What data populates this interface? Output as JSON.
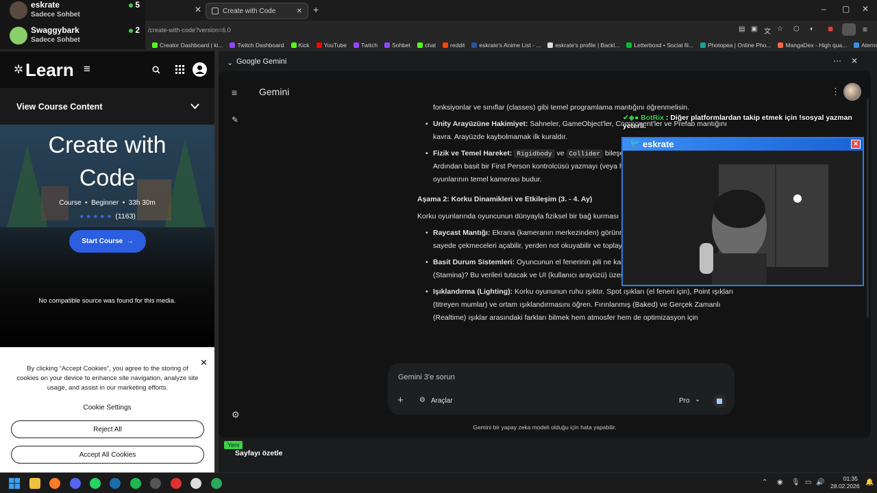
{
  "overlay": {
    "chatters": [
      {
        "name": "eskrate",
        "status": "Sadece Sohbet",
        "count": "5",
        "color": "#5a4a40"
      },
      {
        "name": "Swaggybark",
        "status": "Sadece Sohbet",
        "count": "2",
        "color": "#8ad06a"
      }
    ],
    "botrix_name": "BotRix",
    "botrix_message": "Diğer platformlardan takip etmek için !sosyal yazman yeterli.",
    "cam_title": "eskrate"
  },
  "browser": {
    "tab_title": "Create with Code",
    "url": "/create-with-code?version=6.0",
    "bookmarks": [
      {
        "label": "Creator Dashboard | ki...",
        "color": "#53fc18"
      },
      {
        "label": "Twitch Dashboard",
        "color": "#9146ff"
      },
      {
        "label": "Kick",
        "color": "#53fc18"
      },
      {
        "label": "YouTube",
        "color": "#ff0000"
      },
      {
        "label": "Twitch",
        "color": "#9146ff"
      },
      {
        "label": "Sohbet",
        "color": "#9146ff"
      },
      {
        "label": "chat",
        "color": "#53fc18"
      },
      {
        "label": "reddit",
        "color": "#ff4500"
      },
      {
        "label": "eskrate's Anime List - ...",
        "color": "#2e51a2"
      },
      {
        "label": "eskrate's profile | Backl...",
        "color": "#dddddd"
      },
      {
        "label": "Letterboxd • Social fil...",
        "color": "#00c030"
      },
      {
        "label": "Photopea | Online Pho...",
        "color": "#18a497"
      },
      {
        "label": "MangaDex - High qua...",
        "color": "#ff6740"
      },
      {
        "label": "Aternos",
        "color": "#3b8fe0"
      }
    ]
  },
  "learn": {
    "logo": "Learn",
    "view_course": "View Course Content",
    "title_line1": "Create with",
    "title_line2": "Code",
    "meta_type": "Course",
    "meta_level": "Beginner",
    "meta_duration": "33h 30m",
    "rating_count": "(1163)",
    "start_button": "Start Course",
    "no_source": "No compatible source was found for this media."
  },
  "cookie": {
    "text": "By clicking “Accept Cookies”, you agree to the storing of cookies on your device to enhance site navigation, analyze site usage, and assist in our marketing efforts.",
    "settings": "Cookie Settings",
    "reject": "Reject All",
    "accept": "Accept All Cookies"
  },
  "panel": {
    "title": "Google Gemini",
    "app_name": "Gemini",
    "bottom_badge": "Yeni",
    "bottom_action": "Sayfayı özetle"
  },
  "gemini": {
    "top_fragment": "fonksiyonlar ve sınıflar (classes) gibi temel programlama mantığını öğrenmelisin.",
    "items1": [
      {
        "bold": "Unity Arayüzüne Hakimiyet:",
        "text": " Sahneler, GameObject'ler, Component'ler ve Prefab mantığını kavra. Arayüzde kaybolmamak ilk kuraldır."
      },
      {
        "bold": "Fizik ve Temel Hareket:",
        "code1": "Rigidbody",
        "mid": " ve ",
        "code2": "Collider",
        "text": " bileşenleriyle dünyayla etkileşimini anla. Ardından basit bir First Person kontrolcüsü yazmayı (veya hazır olanları inceleyerek nasıl oyunlarının temel kamerası budur."
      }
    ],
    "stage2_title": "Aşama 2: Korku Dinamikleri ve Etkileşim (3. - 4. Ay)",
    "stage2_intro": "Korku oyunlarında oyuncunun dünyayla fiziksel bir bağ kurması",
    "items2": [
      {
        "bold": "Raycast Mantığı:",
        "text": " Ekrana (kameranın merkezinden) görünmez bir ışın göndererek algılama. Bu sayede çekmeceleri açabilir, yerden not okuyabilir ve toplayabilirsin."
      },
      {
        "bold": "Basit Durum Sistemleri:",
        "text": " Oyuncunun el fenerinin pili ne kadar kaldı? Ne kadar koşabilir (Stamina)? Bu verileri tutacak ve UI (kullanıcı arayüzü) üzerinde gösterecek sistemler inşa et."
      },
      {
        "bold": "Işıklandırma (Lighting):",
        "text": " Korku oyununun ruhu ışıktır. Spot ışıkları (el feneri için), Point ışıkları (titreyen mumlar) ve ortam ışıklandırmasını öğren. Fırınlanmış (Baked) ve Gerçek Zamanlı (Realtime) ışıklar arasındaki farkları bilmek hem atmosfer hem de optimizasyon için"
      }
    ],
    "input_placeholder": "Gemini 3'e sorun",
    "tools": "Araçlar",
    "model": "Pro",
    "disclaimer": "Gemini bir yapay zeka modeli olduğu için hata yapabilir."
  },
  "taskbar": {
    "time": "01:35",
    "date": "28.02.2026"
  }
}
